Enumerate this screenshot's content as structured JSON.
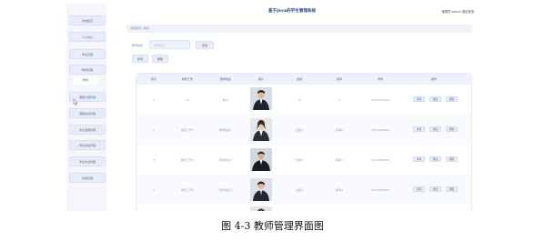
{
  "app": {
    "title": "基于Java的学生管理系统",
    "user": "管理员 admin",
    "logout": "退出登录"
  },
  "sidebar": {
    "items": [
      "系统首页",
      "个人中心",
      "学生管理",
      "教师管理",
      "课程分类管理",
      "课程信息管理",
      "学生选课管理",
      "学生成绩管理",
      "学生作业管理",
      "系统管理"
    ],
    "sub_item": "教师"
  },
  "breadcrumb": {
    "home": "系统首页",
    "separator": "/",
    "current": "教师"
  },
  "search": {
    "label": "教师姓名",
    "placeholder": "教师姓名",
    "button": "查询"
  },
  "toolbar": {
    "add": "新增",
    "delete": "删除"
  },
  "table": {
    "columns": [
      "索引",
      "教师工号",
      "教师姓名",
      "照片",
      "性别",
      "职称",
      "手机",
      "操作"
    ],
    "rows": [
      {
        "index": "1",
        "id": "22",
        "name": "教11",
        "gender": "11",
        "title": "2",
        "phone": "13334780567"
      },
      {
        "index": "2",
        "id": "教师工号2",
        "name": "教师姓名2",
        "gender": "性别2",
        "title": "职称2",
        "phone": "13823888882"
      },
      {
        "index": "3",
        "id": "教师工号3",
        "name": "教师姓名3",
        "gender": "性别3",
        "title": "职称3",
        "phone": "13823888883"
      },
      {
        "index": "4",
        "id": "教师工号4",
        "name": "教师姓名4",
        "gender": "性别4",
        "title": "职称4",
        "phone": "13823888884"
      }
    ],
    "actions": [
      "详情",
      "修改",
      "删除"
    ]
  },
  "caption": "图 4-3 教师管理界面图"
}
